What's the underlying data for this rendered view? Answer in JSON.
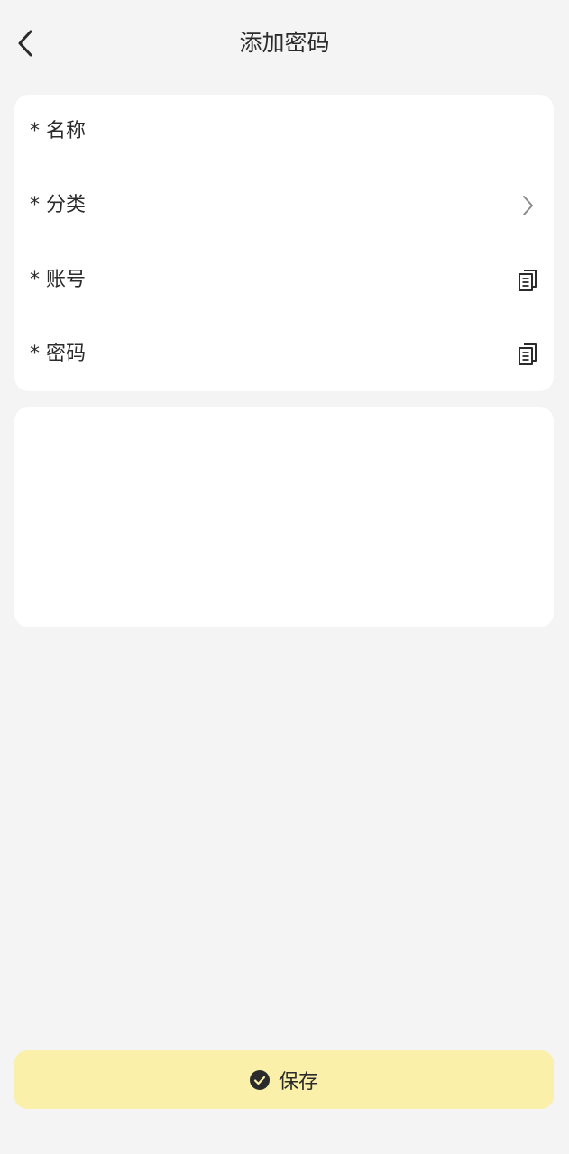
{
  "header": {
    "title": "添加密码",
    "back_icon": "chevron-left-icon"
  },
  "form": {
    "fields": [
      {
        "label": "* 名称",
        "value": "",
        "trailing_icon": null
      },
      {
        "label": "* 分类",
        "value": "",
        "trailing_icon": "chevron-right-icon"
      },
      {
        "label": "* 账号",
        "value": "",
        "trailing_icon": "copy-icon"
      },
      {
        "label": "* 密码",
        "value": "",
        "trailing_icon": "copy-icon"
      }
    ],
    "notes_value": ""
  },
  "save_button": {
    "label": "保存",
    "icon": "check-circle-icon"
  },
  "colors": {
    "background": "#f4f4f4",
    "card": "#ffffff",
    "save_button": "#faf0aa",
    "text": "#2b2b2b",
    "icon_muted": "#8a8a8a"
  }
}
